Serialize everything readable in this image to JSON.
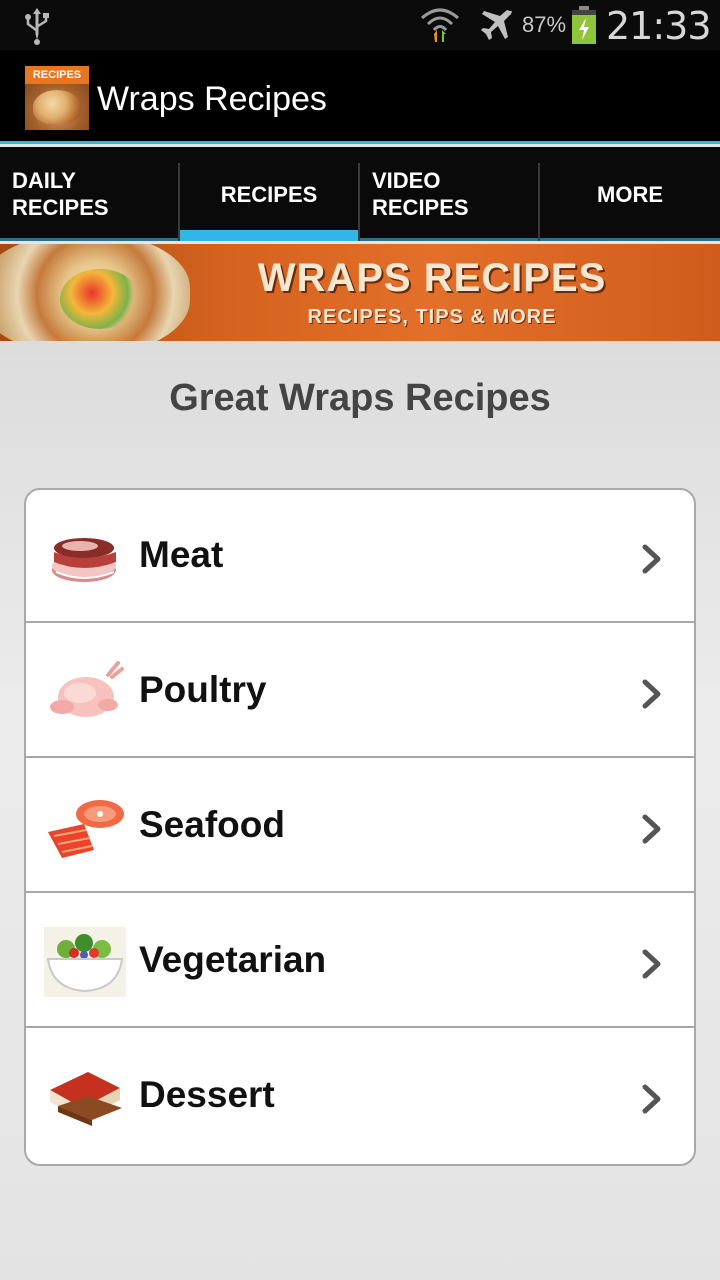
{
  "status_bar": {
    "battery_percent": "87%",
    "time": "21:33",
    "icons": [
      "usb-icon",
      "wifi-icon",
      "airplane-mode-icon",
      "battery-charging-icon"
    ]
  },
  "action_bar": {
    "app_icon_label": "RECIPES",
    "title": "Wraps Recipes"
  },
  "tabs": [
    {
      "label": "DAILY\nRECIPES",
      "selected": false
    },
    {
      "label": "RECIPES",
      "selected": true
    },
    {
      "label": "VIDEO\nRECIPES",
      "selected": false
    },
    {
      "label": "MORE",
      "selected": false
    }
  ],
  "banner": {
    "title": "WRAPS RECIPES",
    "subtitle": "RECIPES, TIPS & MORE"
  },
  "main": {
    "heading": "Great Wraps Recipes",
    "categories": [
      {
        "label": "Meat",
        "icon": "meat-icon"
      },
      {
        "label": "Poultry",
        "icon": "poultry-icon"
      },
      {
        "label": "Seafood",
        "icon": "seafood-icon"
      },
      {
        "label": "Vegetarian",
        "icon": "salad-icon"
      },
      {
        "label": "Dessert",
        "icon": "dessert-icon"
      }
    ]
  },
  "colors": {
    "accent": "#33b5e5",
    "banner_orange": "#d4621e",
    "action_bar": "#000000"
  }
}
